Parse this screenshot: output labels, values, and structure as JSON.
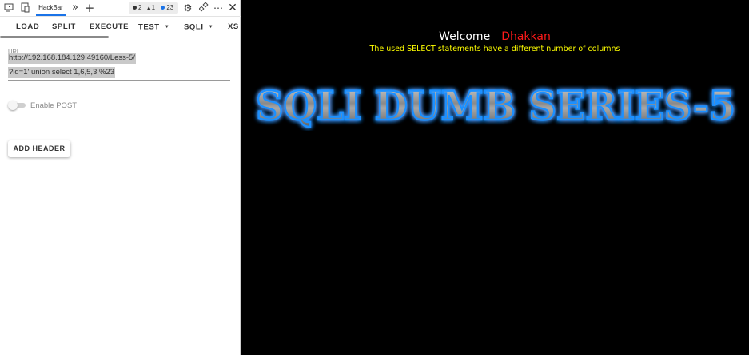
{
  "devtools": {
    "active_tab": "HackBar",
    "issues": {
      "errors": "2",
      "warnings": "1",
      "messages": "23"
    },
    "icons": [
      "device-toggle-icon",
      "inspect-icon",
      "more-tabs-icon",
      "add-tab-icon",
      "settings-icon",
      "connect-icon",
      "more-options-icon",
      "close-icon"
    ]
  },
  "hackbar": {
    "toolbar": {
      "load": "LOAD",
      "split": "SPLIT",
      "execute": "EXECUTE",
      "test": "TEST",
      "sqli": "SQLI",
      "xss": "XS"
    },
    "url_label": "URL",
    "url_line1": "http://192.168.184.129:49160/Less-5/",
    "url_line2": "?id=1' union select 1,6,5,3 %23",
    "enable_post_label": "Enable POST",
    "enable_post": false,
    "add_header_label": "ADD HEADER"
  },
  "page": {
    "welcome": "Welcome",
    "username": "Dhakkan",
    "error_message": "The used SELECT statements have a different number of columns",
    "banner_text": "SQLI DUMB SERIES-5",
    "colors": {
      "background": "#000000",
      "welcome": "#ffffff",
      "username": "#ff1a1a",
      "error": "#ffff00",
      "banner_glow": "#1e90ff"
    }
  }
}
